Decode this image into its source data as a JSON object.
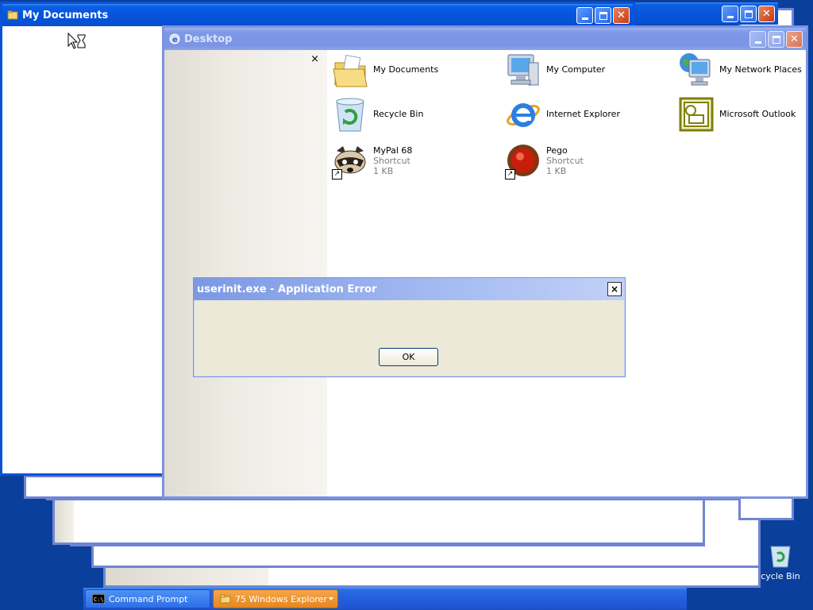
{
  "windows": {
    "my_documents": {
      "title": "My Documents"
    },
    "desktop": {
      "title": "Desktop"
    }
  },
  "desktop_items": [
    {
      "label": "My Documents",
      "icon": "folder-documents-icon"
    },
    {
      "label": "My Computer",
      "icon": "computer-icon"
    },
    {
      "label": "My Network Places",
      "icon": "network-places-icon"
    },
    {
      "label": "Recycle Bin",
      "icon": "recycle-bin-icon"
    },
    {
      "label": "Internet Explorer",
      "icon": "internet-explorer-icon"
    },
    {
      "label": "Microsoft Outlook",
      "icon": "outlook-icon"
    },
    {
      "label": "MyPal 68",
      "sub1": "Shortcut",
      "sub2": "1 KB",
      "icon": "raccoon-icon"
    },
    {
      "label": "Pego",
      "sub1": "Shortcut",
      "sub2": "1 KB",
      "icon": "pego-icon"
    }
  ],
  "tasks_pane": {
    "close_glyph": "×"
  },
  "dialog": {
    "title": "userinit.exe - Application Error",
    "close_glyph": "×",
    "ok_label": "OK"
  },
  "taskbar": {
    "items": [
      {
        "label": "Command Prompt",
        "icon": "cmd-icon"
      },
      {
        "label": "75 Windows Explorer",
        "icon": "folder-icon"
      }
    ]
  },
  "desktop_bg_icon": {
    "label": "cycle Bin"
  },
  "colors": {
    "titlebar_active": "#0654dc",
    "desktop_bg": "#0a3f9c",
    "taskbar_group": "#e8861c"
  }
}
